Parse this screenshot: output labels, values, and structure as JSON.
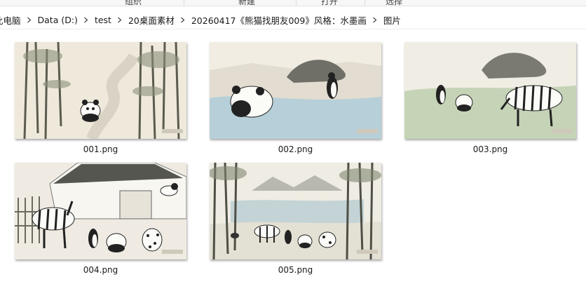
{
  "ribbon": {
    "groups": [
      "组织",
      "新建",
      "打开",
      "选择"
    ]
  },
  "breadcrumb": {
    "items": [
      "此电脑",
      "Data (D:)",
      "test",
      "20桌面素材",
      "20260417《熊猫找朋友009》风格：水墨画",
      "图片"
    ]
  },
  "files": [
    {
      "name": "001.png",
      "icon": "bamboo-panda-thumbnail"
    },
    {
      "name": "002.png",
      "icon": "panda-penguin-water-thumbnail"
    },
    {
      "name": "003.png",
      "icon": "panda-penguin-zebra-thumbnail"
    },
    {
      "name": "004.png",
      "icon": "village-animals-thumbnail"
    },
    {
      "name": "005.png",
      "icon": "lake-bamboo-animals-thumbnail"
    }
  ],
  "colors": {
    "paper": "#efe9dc",
    "ink": "#2b2b2b",
    "water": "#b7cfd8",
    "grass": "#a9c29a"
  }
}
